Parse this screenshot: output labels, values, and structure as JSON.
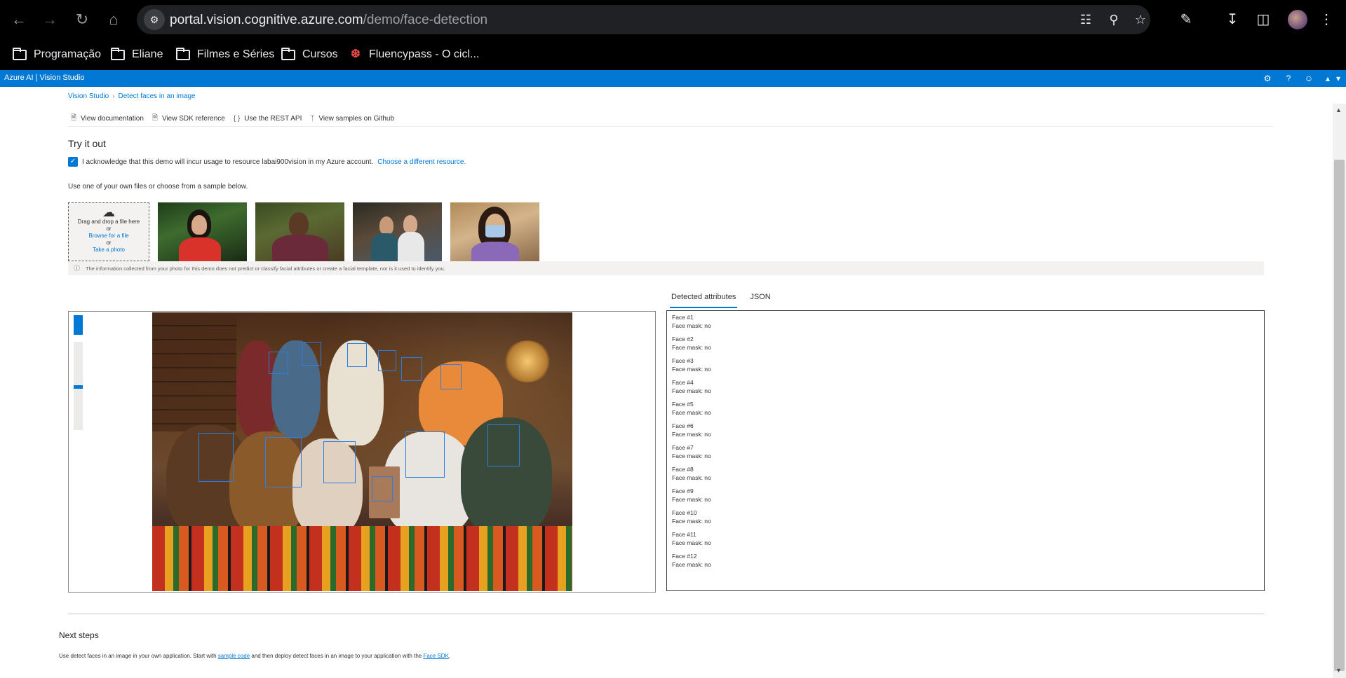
{
  "browser": {
    "url_domain": "portal.vision.cognitive.azure.com",
    "url_path": "/demo/face-detection",
    "bookmarks": [
      {
        "label": "Programação",
        "icon": "folder-icon"
      },
      {
        "label": "Eliane",
        "icon": "folder-icon"
      },
      {
        "label": "Filmes e Séries",
        "icon": "folder-icon"
      },
      {
        "label": "Cursos",
        "icon": "folder-icon"
      },
      {
        "label": "Fluencypass - O cicl...",
        "icon": "fluencypass-icon"
      }
    ]
  },
  "header": {
    "brand": "Azure AI | Vision Studio",
    "accent_color": "#0078d4"
  },
  "breadcrumb": {
    "root": "Vision Studio",
    "current": "Detect faces in an image"
  },
  "resource_links": [
    {
      "label": "View documentation",
      "icon": "document-icon"
    },
    {
      "label": "View SDK reference",
      "icon": "document-icon"
    },
    {
      "label": "Use the REST API",
      "icon": "braces-icon"
    },
    {
      "label": "View samples on Github",
      "icon": "branch-icon"
    }
  ],
  "try_it": {
    "title": "Try it out",
    "acknowledge": "I acknowledge that this demo will incur usage to resource labai900vision in my Azure account.",
    "choose_resource": "Choose a different resource.",
    "use_text": "Use one of your own files or choose from a sample below.",
    "upload": {
      "drag": "Drag and drop a file here",
      "or1": "or",
      "browse": "Browse for a file",
      "or2": "or",
      "photo": "Take a photo"
    },
    "privacy": "The information collected from your photo for this demo does not predict or classify facial attributes or create a facial template, nor is it used to identify you."
  },
  "results": {
    "tabs": [
      "Detected attributes",
      "JSON"
    ],
    "faces": [
      {
        "label": "Face #1",
        "mask": "Face mask: no"
      },
      {
        "label": "Face #2",
        "mask": "Face mask: no"
      },
      {
        "label": "Face #3",
        "mask": "Face mask: no"
      },
      {
        "label": "Face #4",
        "mask": "Face mask: no"
      },
      {
        "label": "Face #5",
        "mask": "Face mask: no"
      },
      {
        "label": "Face #6",
        "mask": "Face mask: no"
      },
      {
        "label": "Face #7",
        "mask": "Face mask: no"
      },
      {
        "label": "Face #8",
        "mask": "Face mask: no"
      },
      {
        "label": "Face #9",
        "mask": "Face mask: no"
      },
      {
        "label": "Face #10",
        "mask": "Face mask: no"
      },
      {
        "label": "Face #11",
        "mask": "Face mask: no"
      },
      {
        "label": "Face #12",
        "mask": "Face mask: no"
      }
    ]
  },
  "next_steps": {
    "title": "Next steps",
    "text_before": "Use detect faces in an image in your own application. Start with",
    "sample_link": "sample code",
    "text_middle": "and then deploy detect faces in an image to your application with the",
    "sdk_link": "Face SDK",
    "text_after": "."
  }
}
